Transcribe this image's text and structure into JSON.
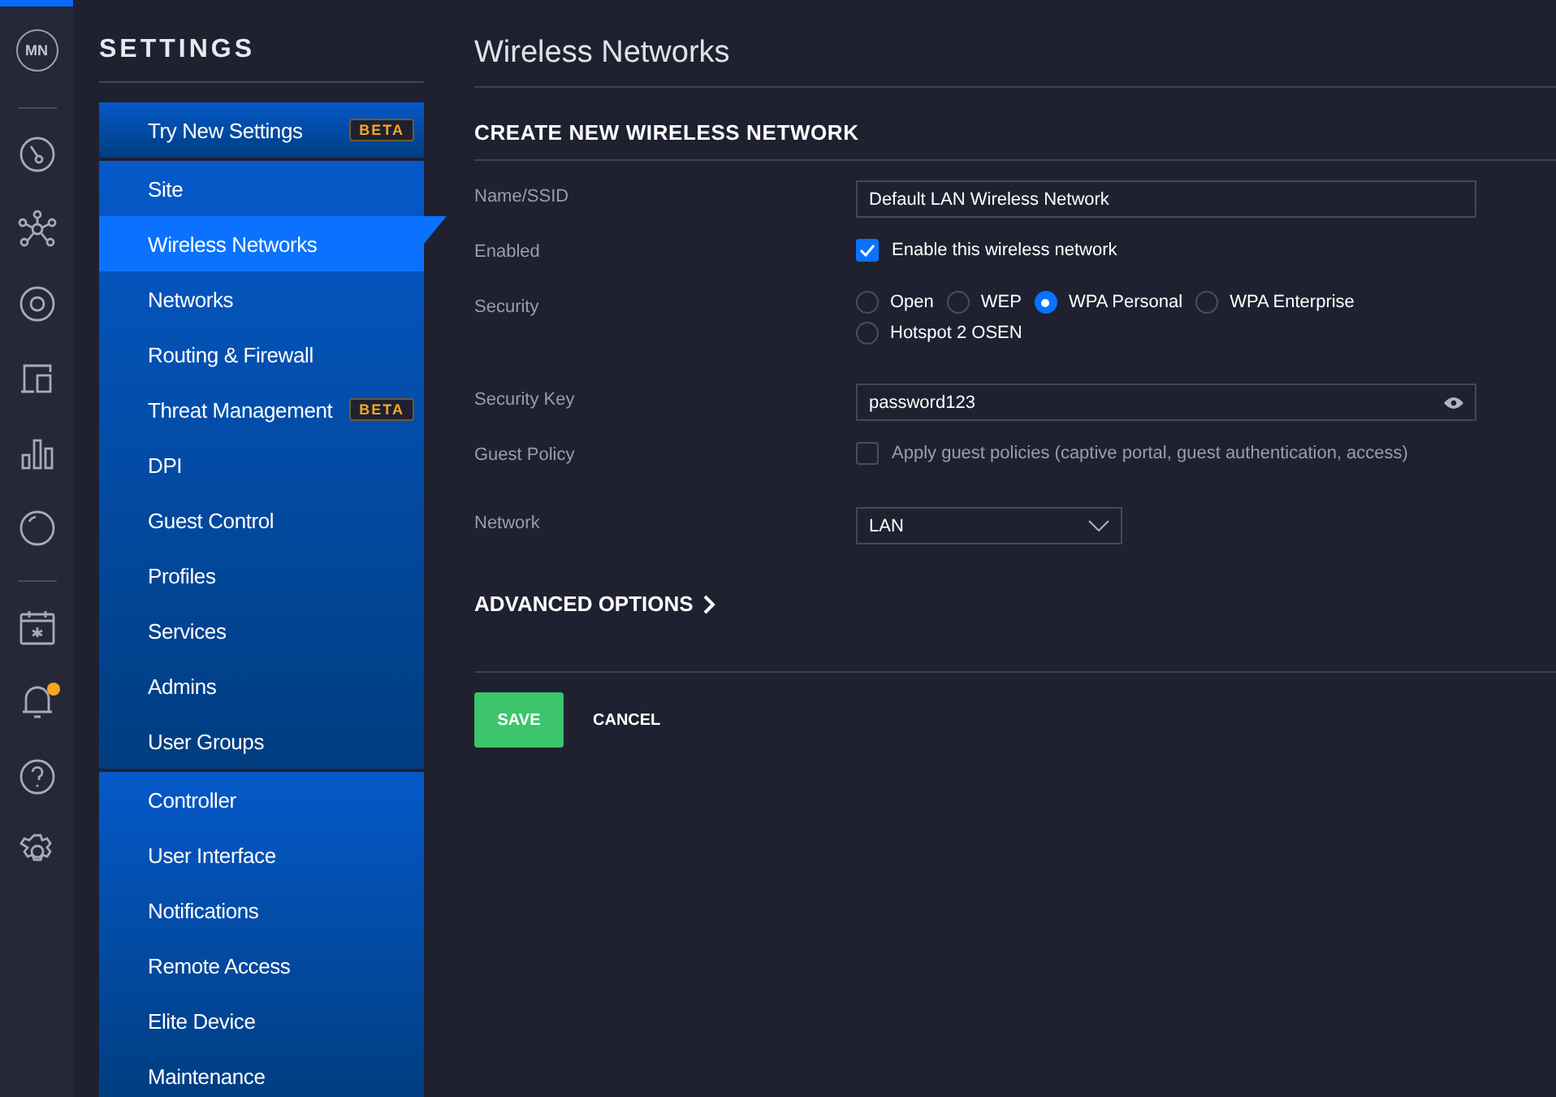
{
  "rail": {
    "avatar": "MN",
    "icons": [
      {
        "kind": "dashboard",
        "notification": false
      },
      {
        "kind": "topology",
        "notification": false
      },
      {
        "kind": "devices",
        "notification": false
      },
      {
        "kind": "clients",
        "notification": false
      },
      {
        "kind": "statistics",
        "notification": false
      },
      {
        "kind": "insights",
        "notification": false
      },
      {
        "kind": "events",
        "notification": false
      },
      {
        "kind": "alerts",
        "notification": true
      },
      {
        "kind": "help",
        "notification": false
      },
      {
        "kind": "settings",
        "notification": false
      }
    ]
  },
  "sidebar": {
    "title": "SETTINGS",
    "groups": [
      {
        "items": [
          {
            "label": "Try New Settings",
            "badge": "BETA",
            "selected": false
          }
        ]
      },
      {
        "items": [
          {
            "label": "Site",
            "selected": false
          },
          {
            "label": "Wireless Networks",
            "selected": true
          },
          {
            "label": "Networks",
            "selected": false
          },
          {
            "label": "Routing & Firewall",
            "selected": false
          },
          {
            "label": "Threat Management",
            "badge": "BETA",
            "selected": false
          },
          {
            "label": "DPI",
            "selected": false
          },
          {
            "label": "Guest Control",
            "selected": false
          },
          {
            "label": "Profiles",
            "selected": false
          },
          {
            "label": "Services",
            "selected": false
          },
          {
            "label": "Admins",
            "selected": false
          },
          {
            "label": "User Groups",
            "selected": false
          }
        ]
      },
      {
        "items": [
          {
            "label": "Controller",
            "selected": false
          },
          {
            "label": "User Interface",
            "selected": false
          },
          {
            "label": "Notifications",
            "selected": false
          },
          {
            "label": "Remote Access",
            "selected": false
          },
          {
            "label": "Elite Device",
            "selected": false
          },
          {
            "label": "Maintenance",
            "selected": false
          }
        ]
      }
    ]
  },
  "page": {
    "title": "Wireless Networks",
    "section_title": "CREATE NEW WIRELESS NETWORK",
    "fields": [
      {
        "kind": "text",
        "label": "Name/SSID",
        "value": "Default LAN Wireless Network"
      },
      {
        "kind": "checkbox",
        "label": "Enabled",
        "text": "Enable this wireless network",
        "checked": true
      },
      {
        "kind": "radio",
        "label": "Security",
        "options": [
          {
            "label": "Open",
            "selected": false
          },
          {
            "label": "WEP",
            "selected": false
          },
          {
            "label": "WPA Personal",
            "selected": true
          },
          {
            "label": "WPA Enterprise",
            "selected": false
          },
          {
            "label": "Hotspot 2 OSEN",
            "selected": false
          }
        ]
      },
      {
        "kind": "password",
        "label": "Security Key",
        "value": "password123"
      },
      {
        "kind": "checkbox",
        "label": "Guest Policy",
        "text": "Apply guest policies (captive portal, guest authentication, access)",
        "checked": false
      },
      {
        "kind": "select",
        "label": "Network",
        "value": "LAN"
      }
    ],
    "advanced": "ADVANCED OPTIONS",
    "buttons": {
      "save": "SAVE",
      "cancel": "CANCEL"
    }
  }
}
